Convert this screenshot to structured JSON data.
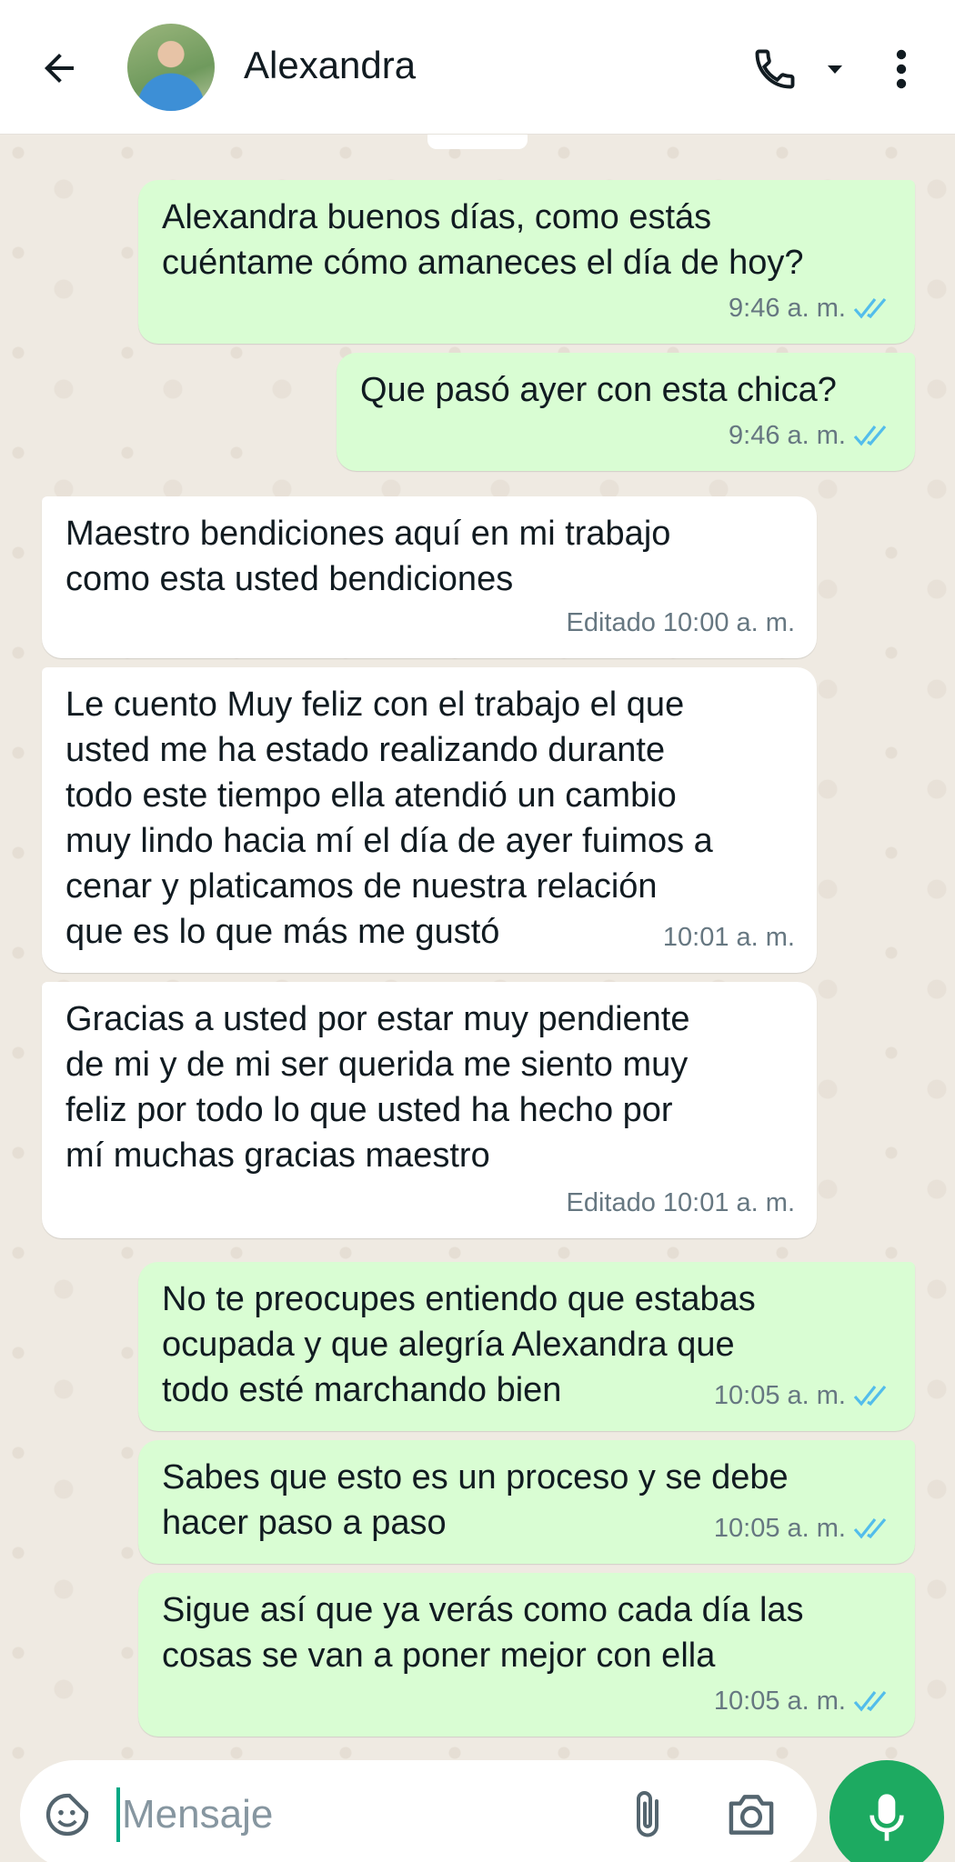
{
  "header": {
    "contact_name": "Alexandra",
    "icons": [
      "back-arrow-icon",
      "phone-icon",
      "caret-down-icon",
      "more-vert-icon"
    ]
  },
  "messages": [
    {
      "direction": "outgoing",
      "text": "Alexandra buenos días, como estás\ncuéntame cómo amaneces el día de hoy?",
      "time": "9:46 a. m.",
      "read": true
    },
    {
      "direction": "outgoing",
      "text": "Que pasó ayer con esta chica?",
      "time": "9:46 a. m.",
      "read": true
    },
    {
      "direction": "incoming",
      "text": "Maestro bendiciones aquí en mi trabajo\ncomo esta usted bendiciones",
      "time": "Editado 10:00 a. m."
    },
    {
      "direction": "incoming",
      "text": "Le cuento Muy feliz con el trabajo el que\nusted me ha estado realizando durante\ntodo este tiempo ella atendió un cambio\nmuy lindo hacia mí el día de ayer fuimos a\ncenar y platicamos de nuestra relación\nque es lo que más me gustó",
      "time": "10:01 a. m."
    },
    {
      "direction": "incoming",
      "text": "Gracias a usted por estar muy pendiente\nde mi y de mi ser querida me siento muy\nfeliz por todo lo que usted ha hecho por\nmí muchas gracias maestro",
      "time": "Editado 10:01 a. m."
    },
    {
      "direction": "outgoing",
      "text": "No te preocupes entiendo que estabas\nocupada y que alegría Alexandra que\ntodo esté marchando bien",
      "time": "10:05 a. m.",
      "read": true
    },
    {
      "direction": "outgoing",
      "text": "Sabes que esto es un proceso y se debe\nhacer paso a paso",
      "time": "10:05 a. m.",
      "read": true
    },
    {
      "direction": "outgoing",
      "text": "Sigue así que ya verás como cada día las\ncosas se van a poner mejor con ella",
      "time": "10:05 a. m.",
      "read": true
    }
  ],
  "input": {
    "placeholder": "Mensaje",
    "icons": [
      "sticker-icon",
      "attach-icon",
      "camera-icon",
      "mic-icon"
    ]
  },
  "colors": {
    "outgoing_bubble": "#d9fdd3",
    "incoming_bubble": "#ffffff",
    "read_ticks": "#53bdeb",
    "mic_button": "#1daa61"
  }
}
